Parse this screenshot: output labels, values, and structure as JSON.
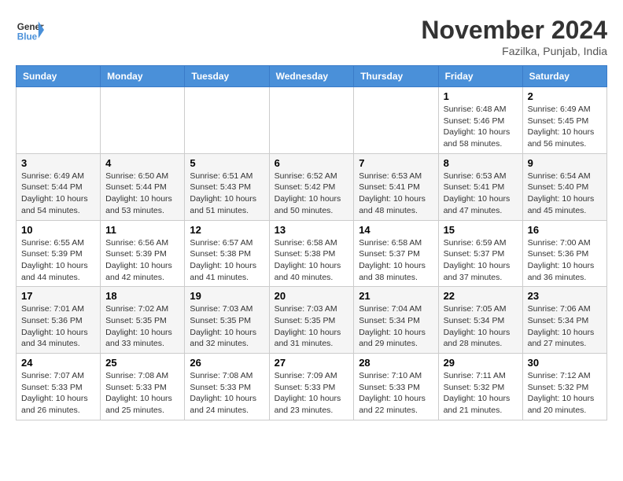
{
  "header": {
    "logo_line1": "General",
    "logo_line2": "Blue",
    "month": "November 2024",
    "location": "Fazilka, Punjab, India"
  },
  "weekdays": [
    "Sunday",
    "Monday",
    "Tuesday",
    "Wednesday",
    "Thursday",
    "Friday",
    "Saturday"
  ],
  "weeks": [
    [
      null,
      null,
      null,
      null,
      null,
      {
        "day": "1",
        "sunrise": "6:48 AM",
        "sunset": "5:46 PM",
        "daylight": "10 hours and 58 minutes."
      },
      {
        "day": "2",
        "sunrise": "6:49 AM",
        "sunset": "5:45 PM",
        "daylight": "10 hours and 56 minutes."
      }
    ],
    [
      {
        "day": "3",
        "sunrise": "6:49 AM",
        "sunset": "5:44 PM",
        "daylight": "10 hours and 54 minutes."
      },
      {
        "day": "4",
        "sunrise": "6:50 AM",
        "sunset": "5:44 PM",
        "daylight": "10 hours and 53 minutes."
      },
      {
        "day": "5",
        "sunrise": "6:51 AM",
        "sunset": "5:43 PM",
        "daylight": "10 hours and 51 minutes."
      },
      {
        "day": "6",
        "sunrise": "6:52 AM",
        "sunset": "5:42 PM",
        "daylight": "10 hours and 50 minutes."
      },
      {
        "day": "7",
        "sunrise": "6:53 AM",
        "sunset": "5:41 PM",
        "daylight": "10 hours and 48 minutes."
      },
      {
        "day": "8",
        "sunrise": "6:53 AM",
        "sunset": "5:41 PM",
        "daylight": "10 hours and 47 minutes."
      },
      {
        "day": "9",
        "sunrise": "6:54 AM",
        "sunset": "5:40 PM",
        "daylight": "10 hours and 45 minutes."
      }
    ],
    [
      {
        "day": "10",
        "sunrise": "6:55 AM",
        "sunset": "5:39 PM",
        "daylight": "10 hours and 44 minutes."
      },
      {
        "day": "11",
        "sunrise": "6:56 AM",
        "sunset": "5:39 PM",
        "daylight": "10 hours and 42 minutes."
      },
      {
        "day": "12",
        "sunrise": "6:57 AM",
        "sunset": "5:38 PM",
        "daylight": "10 hours and 41 minutes."
      },
      {
        "day": "13",
        "sunrise": "6:58 AM",
        "sunset": "5:38 PM",
        "daylight": "10 hours and 40 minutes."
      },
      {
        "day": "14",
        "sunrise": "6:58 AM",
        "sunset": "5:37 PM",
        "daylight": "10 hours and 38 minutes."
      },
      {
        "day": "15",
        "sunrise": "6:59 AM",
        "sunset": "5:37 PM",
        "daylight": "10 hours and 37 minutes."
      },
      {
        "day": "16",
        "sunrise": "7:00 AM",
        "sunset": "5:36 PM",
        "daylight": "10 hours and 36 minutes."
      }
    ],
    [
      {
        "day": "17",
        "sunrise": "7:01 AM",
        "sunset": "5:36 PM",
        "daylight": "10 hours and 34 minutes."
      },
      {
        "day": "18",
        "sunrise": "7:02 AM",
        "sunset": "5:35 PM",
        "daylight": "10 hours and 33 minutes."
      },
      {
        "day": "19",
        "sunrise": "7:03 AM",
        "sunset": "5:35 PM",
        "daylight": "10 hours and 32 minutes."
      },
      {
        "day": "20",
        "sunrise": "7:03 AM",
        "sunset": "5:35 PM",
        "daylight": "10 hours and 31 minutes."
      },
      {
        "day": "21",
        "sunrise": "7:04 AM",
        "sunset": "5:34 PM",
        "daylight": "10 hours and 29 minutes."
      },
      {
        "day": "22",
        "sunrise": "7:05 AM",
        "sunset": "5:34 PM",
        "daylight": "10 hours and 28 minutes."
      },
      {
        "day": "23",
        "sunrise": "7:06 AM",
        "sunset": "5:34 PM",
        "daylight": "10 hours and 27 minutes."
      }
    ],
    [
      {
        "day": "24",
        "sunrise": "7:07 AM",
        "sunset": "5:33 PM",
        "daylight": "10 hours and 26 minutes."
      },
      {
        "day": "25",
        "sunrise": "7:08 AM",
        "sunset": "5:33 PM",
        "daylight": "10 hours and 25 minutes."
      },
      {
        "day": "26",
        "sunrise": "7:08 AM",
        "sunset": "5:33 PM",
        "daylight": "10 hours and 24 minutes."
      },
      {
        "day": "27",
        "sunrise": "7:09 AM",
        "sunset": "5:33 PM",
        "daylight": "10 hours and 23 minutes."
      },
      {
        "day": "28",
        "sunrise": "7:10 AM",
        "sunset": "5:33 PM",
        "daylight": "10 hours and 22 minutes."
      },
      {
        "day": "29",
        "sunrise": "7:11 AM",
        "sunset": "5:32 PM",
        "daylight": "10 hours and 21 minutes."
      },
      {
        "day": "30",
        "sunrise": "7:12 AM",
        "sunset": "5:32 PM",
        "daylight": "10 hours and 20 minutes."
      }
    ]
  ]
}
